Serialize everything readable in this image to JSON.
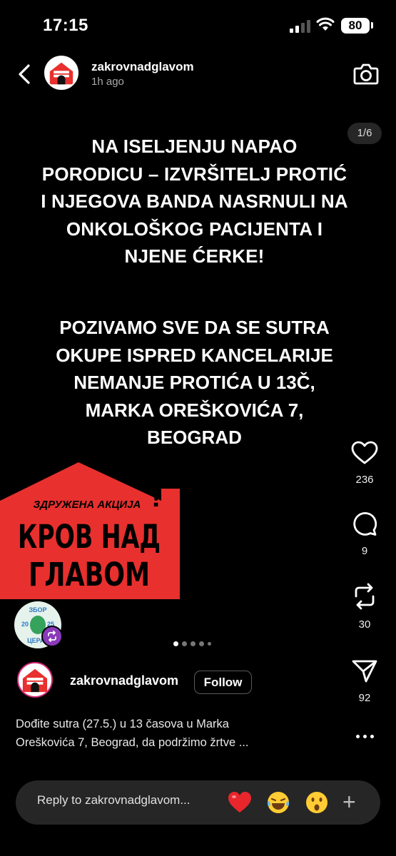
{
  "status_bar": {
    "time": "17:15",
    "battery": "80"
  },
  "header": {
    "username": "zakrovnadglavom",
    "time_ago": "1h ago"
  },
  "slide": {
    "counter": "1/6",
    "headline_lines": [
      "NA ISELJENJU NAPAO",
      "PORODICU – IZVRŠITELJ PROTIĆ",
      "I NJEGOVA BANDA NASRNULI NA",
      "ONKOLOŠKOG PACIJENTA I",
      "NJENE ĆERKE!"
    ],
    "call_lines": [
      "POZIVAMO SVE DA SE SUTRA",
      "OKUPE ISPRED KANCELARIJE",
      "NEMANJE PROTIĆA U 13Č,",
      "MARKA  OREŠKOVIĆA 7,",
      "BEOGRAD"
    ],
    "logo": {
      "top_line": "ЗДРУЖЕНА АКЦИЈА",
      "line1": "КРОВ НАД",
      "line2": "ГЛАВОМ",
      "mark": "!",
      "color": "#e8302e"
    },
    "zbor_badge": {
      "top": "ЗБОР",
      "left": "20",
      "right": "25",
      "bottom": "ЦЕРАК"
    },
    "pagination": {
      "count": 5,
      "active": 0
    }
  },
  "actions": {
    "likes": "236",
    "comments": "9",
    "reposts": "30",
    "shares": "92"
  },
  "author": {
    "name": "zakrovnadglavom",
    "follow_label": "Follow",
    "avatar_text": "КРОВ НАД ГЛАВОМ"
  },
  "caption": {
    "line1": "Dođite sutra (27.5.) u 13 časova u Marka",
    "line2": "Oreškovića 7, Beograd, da podržimo žrtve ..."
  },
  "reply": {
    "placeholder": "Reply to zakrovnadglavom..."
  },
  "colors": {
    "accent_red": "#e8302e",
    "repost_purple": "#8a3ab9",
    "bar_bg": "#262626"
  }
}
